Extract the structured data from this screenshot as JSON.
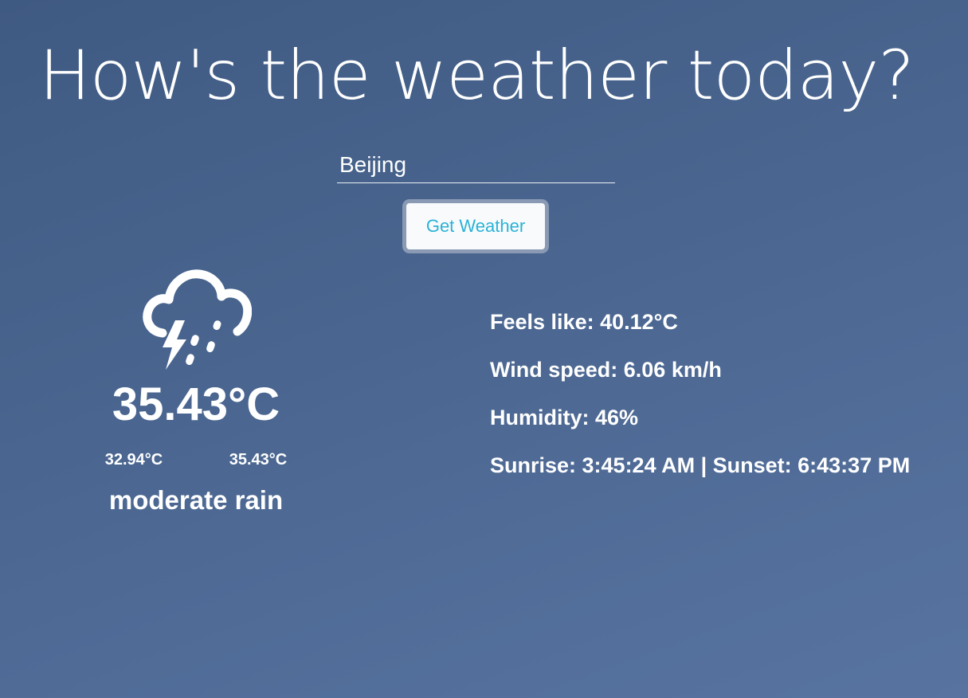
{
  "header": {
    "title": "How's the weather today?"
  },
  "search": {
    "city_value": "Beijing",
    "button_label": "Get Weather"
  },
  "current": {
    "icon": "thunderstorm-rain-cloud-icon",
    "temperature": "35.43°C",
    "temp_min": "32.94°C",
    "temp_max": "35.43°C",
    "description": "moderate rain"
  },
  "details": {
    "feels_like": "Feels like: 40.12°C",
    "wind_speed": "Wind speed: 6.06 km/h",
    "humidity": "Humidity: 46%",
    "sun_times": "Sunrise: 3:45:24 AM | Sunset: 6:43:37 PM"
  },
  "colors": {
    "background_top": "#3f5a82",
    "background_bottom": "#5873a0",
    "button_text": "#2ab3d6",
    "button_border": "#8a9ab4",
    "text": "#ffffff"
  }
}
